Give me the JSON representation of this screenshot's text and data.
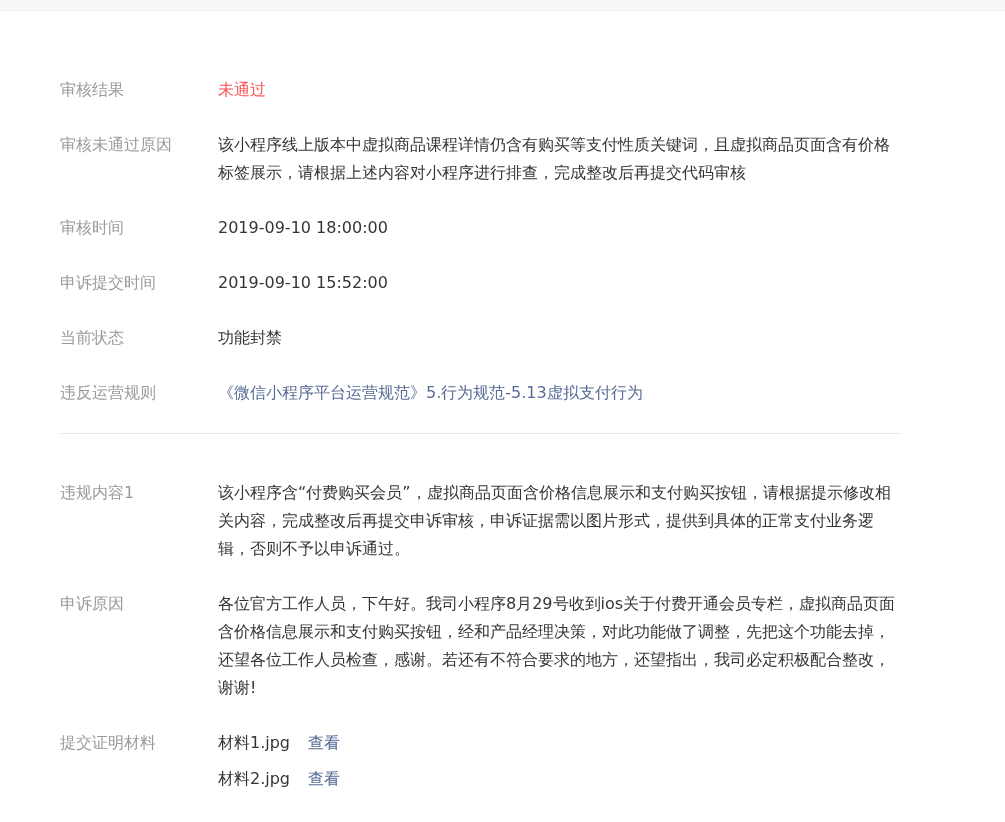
{
  "sections": [
    {
      "rows": [
        {
          "label": "审核结果",
          "kind": "status",
          "value": "未通过"
        },
        {
          "label": "审核未通过原因",
          "kind": "text",
          "value": "该小程序线上版本中虚拟商品课程详情仍含有购买等支付性质关键词，且虚拟商品页面含有价格标签展示，请根据上述内容对小程序进行排查，完成整改后再提交代码审核"
        },
        {
          "label": "审核时间",
          "kind": "text",
          "value": "2019-09-10 18:00:00"
        },
        {
          "label": "申诉提交时间",
          "kind": "text",
          "value": "2019-09-10 15:52:00"
        },
        {
          "label": "当前状态",
          "kind": "text",
          "value": "功能封禁"
        },
        {
          "label": "违反运营规则",
          "kind": "link",
          "value": "《微信小程序平台运营规范》5.行为规范-5.13虚拟支付行为"
        }
      ]
    },
    {
      "rows": [
        {
          "label": "违规内容1",
          "kind": "text",
          "value": "该小程序含“付费购买会员”，虚拟商品页面含价格信息展示和支付购买按钮，请根据提示修改相关内容，完成整改后再提交申诉审核，申诉证据需以图片形式，提供到具体的正常支付业务逻辑，否则不予以申诉通过。"
        },
        {
          "label": "申诉原因",
          "kind": "text",
          "value": "各位官方工作人员，下午好。我司小程序8月29号收到ios关于付费开通会员专栏，虚拟商品页面含价格信息展示和支付购买按钮，经和产品经理决策，对此功能做了调整，先把这个功能去掉，还望各位工作人员检查，感谢。若还有不符合要求的地方，还望指出，我司必定积极配合整改，谢谢!"
        },
        {
          "label": "提交证明材料",
          "kind": "files",
          "files": [
            {
              "name": "材料1.jpg",
              "action": "查看"
            },
            {
              "name": "材料2.jpg",
              "action": "查看"
            }
          ]
        }
      ]
    }
  ]
}
